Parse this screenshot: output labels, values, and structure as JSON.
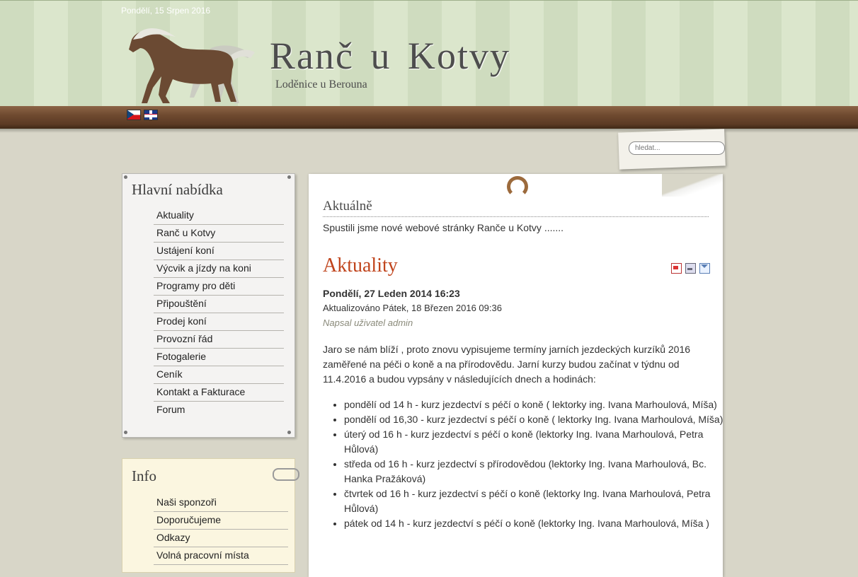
{
  "header": {
    "date": "Pondělí, 15 Srpen 2016",
    "site_title": "Ranč u Kotvy",
    "site_subtitle": "Loděnice u Berouna"
  },
  "languages": [
    "Čeština",
    "English"
  ],
  "search": {
    "placeholder": "hledat..."
  },
  "main_menu": {
    "heading": "Hlavní nabídka",
    "items": [
      "Aktuality",
      "Ranč u Kotvy",
      "Ustájení koní",
      "Výcvik a jízdy na koni",
      "Programy pro děti",
      "Připouštění",
      "Prodej koní",
      "Provozní řád",
      "Fotogalerie",
      "Ceník",
      "Kontakt a Fakturace",
      "Forum"
    ]
  },
  "info_menu": {
    "heading": "Info",
    "items": [
      "Naši sponzoři",
      "Doporučujeme",
      "Odkazy",
      "Volná pracovní místa"
    ]
  },
  "news": {
    "heading": "Aktuálně",
    "text": "Spustili jsme nové webové stránky Ranče u Kotvy ......."
  },
  "article": {
    "title": "Aktuality",
    "date": "Pondělí, 27 Leden 2014 16:23",
    "updated": "Aktualizováno Pátek, 18 Březen 2016 09:36",
    "author": "Napsal uživatel admin",
    "intro": "Jaro se nám blíží , proto znovu  vypisujeme  termíny jarních jezdeckých kurzíků 2016 zaměřené na péči o koně a na přírodovědu. Jarní kurzy budou začínat v týdnu od 11.4.2016 a budou vypsány v následujících dnech a hodinách:",
    "bullets": [
      "pondělí od 14 h - kurz jezdectví s péčí o koně ( lektorky ing.  Ivana Marhoulová, Míša)",
      "pondělí od 16,30 - kurz jezdectví s péčí o koně ( lektorky Ing. Ivana Marhoulová, Míša)",
      "úterý od 16 h - kurz jezdectví s péčí o koně (lektorky Ing. Ivana Marhoulová, Petra Hůlová)",
      "středa od 16 h - kurz jezdectví s přírodovědou (lektorky Ing. Ivana Marhoulová, Bc. Hanka Pražáková)",
      "čtvrtek od 16 h - kurz jezdectví s péčí o koně (lektorky Ing. Ivana Marhoulová, Petra Hůlová)",
      "pátek od 14 h - kurz jezdectví s péčí o koně (lektorky Ing. Ivana Marhoulová, Míša )"
    ]
  },
  "icons": [
    "pdf-icon",
    "print-icon",
    "email-icon",
    "horseshoe-icon",
    "horse-logo"
  ],
  "colors": {
    "article_title": "#c0441c",
    "header_stripe": "#cfdcbf",
    "wood": "#6f4a30"
  }
}
